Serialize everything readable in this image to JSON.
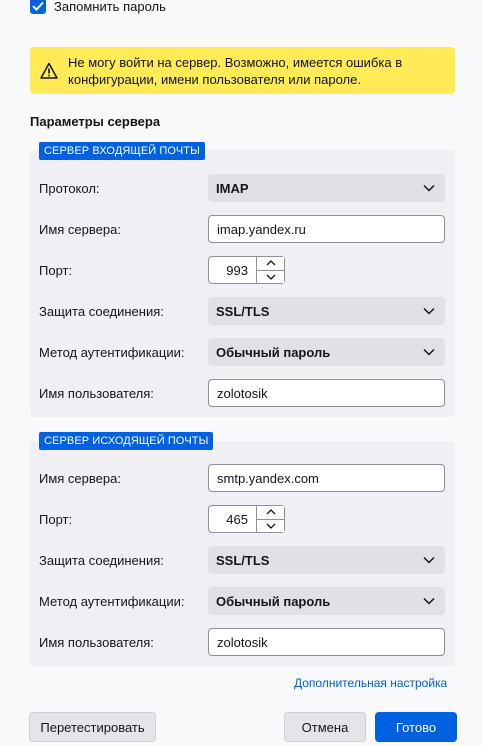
{
  "remember": {
    "label": "Запомнить пароль",
    "checked": true
  },
  "warning": {
    "icon": "warning-icon",
    "text": "Не могу войти на сервер. Возможно, имеется ошибка в конфигурации, имени пользователя или пароле."
  },
  "server_settings": {
    "title": "Параметры сервера",
    "incoming": {
      "badge": "СЕРВЕР ВХОДЯЩЕЙ ПОЧТЫ",
      "protocol_label": "Протокол:",
      "protocol_value": "IMAP",
      "hostname_label": "Имя сервера:",
      "hostname_value": "imap.yandex.ru",
      "port_label": "Порт:",
      "port_value": "993",
      "security_label": "Защита соединения:",
      "security_value": "SSL/TLS",
      "auth_label": "Метод аутентификации:",
      "auth_value": "Обычный пароль",
      "username_label": "Имя пользователя:",
      "username_value": "zolotosik"
    },
    "outgoing": {
      "badge": "СЕРВЕР ИСХОДЯЩЕЙ ПОЧТЫ",
      "hostname_label": "Имя сервера:",
      "hostname_value": "smtp.yandex.com",
      "port_label": "Порт:",
      "port_value": "465",
      "security_label": "Защита соединения:",
      "security_value": "SSL/TLS",
      "auth_label": "Метод аутентификации:",
      "auth_value": "Обычный пароль",
      "username_label": "Имя пользователя:",
      "username_value": "zolotosik"
    }
  },
  "advanced_link": "Дополнительная настройка",
  "buttons": {
    "retest": "Перетестировать",
    "cancel": "Отмена",
    "done": "Готово"
  },
  "colors": {
    "accent": "#0061e0",
    "warning_bg": "#ffeb55"
  }
}
